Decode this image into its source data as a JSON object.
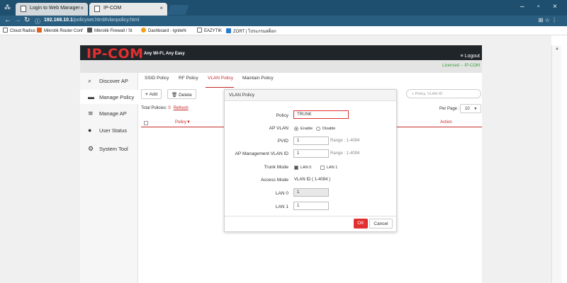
{
  "browser": {
    "tabs": [
      {
        "title": "Login to Web Manager"
      },
      {
        "title": "IP-COM"
      }
    ],
    "url_host": "192.168.10.1",
    "url_path": "/policyset.html#vlanpolicy.html",
    "bookmarks": [
      "Cloud Radius",
      "Mikrotik Router Conf",
      "Mikrotik Firewall / St",
      "Dashboard - IgniteN",
      "EAZYTIK",
      "ZORT | โปรแกรมสต็อก"
    ]
  },
  "header": {
    "logo": "IP-COM",
    "slogan": "Any Wi-Fi, Any Easy",
    "logout": "Logout",
    "licensed": "Licensed -- IP-COM"
  },
  "sidebar": {
    "items": [
      {
        "label": "Discover AP",
        "icon": "discover-icon"
      },
      {
        "label": "Manage Policy",
        "icon": "policy-icon"
      },
      {
        "label": "Manage AP",
        "icon": "wifi-icon"
      },
      {
        "label": "User Status",
        "icon": "user-icon"
      },
      {
        "label": "System Tool",
        "icon": "gear-icon"
      }
    ]
  },
  "policy_tabs": [
    "SSID Policy",
    "RF Policy",
    "VLAN Policy",
    "Maintain Policy"
  ],
  "toolbar": {
    "add": "Add",
    "delete": "Delete"
  },
  "total": {
    "label": "Total Policies:",
    "count": "0",
    "refresh": "Refresh"
  },
  "search": {
    "placeholder": "Policy, VLAN ID"
  },
  "perpage": {
    "label": "Per Page :",
    "value": "10"
  },
  "table": {
    "headers": [
      "Policy▼",
      "Action"
    ]
  },
  "modal": {
    "title": "VLAN Policy",
    "policy_label": "Policy",
    "policy_value": "TRUNK",
    "ap_vlan_label": "AP VLAN",
    "enable": "Enable",
    "disable": "Disable",
    "pvid_label": "PVID",
    "pvid_value": "1",
    "pvid_range": "Range : 1-4094",
    "mgmt_label": "AP Management VLAN ID",
    "mgmt_value": "1",
    "mgmt_range": "Range : 1-4094",
    "trunk_label": "Trunk Mode",
    "lan0_cb": "LAN 0",
    "lan1_cb": "LAN 1",
    "access_label": "Access Mode",
    "access_value": "VLAN ID ( 1-4094 )",
    "lan0_label": "LAN 0",
    "lan0_value": "1",
    "lan1_label": "LAN 1",
    "lan1_value": "1",
    "ok": "OK",
    "cancel": "Cancel"
  }
}
